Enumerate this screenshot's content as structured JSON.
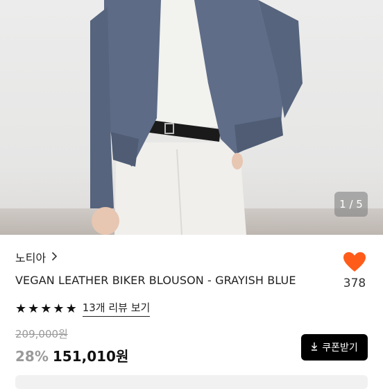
{
  "gallery": {
    "counter": "1 / 5"
  },
  "product": {
    "brand": "노티아",
    "name": "VEGAN LEATHER BIKER BLOUSON - GRAYISH BLUE",
    "likes": "378",
    "rating_stars": 5,
    "review_link": "13개 리뷰 보기",
    "original_price": "209,000원",
    "discount": "28%",
    "final_price": "151,010원"
  },
  "actions": {
    "coupon_label": "쿠폰받기"
  },
  "colors": {
    "heart": "#ff5c1a",
    "jacket": "#5d6b86",
    "button": "#000000"
  },
  "icons": {
    "brand_chevron": "chevron-right-icon",
    "like": "heart-icon",
    "download": "download-icon",
    "star": "star-icon"
  }
}
